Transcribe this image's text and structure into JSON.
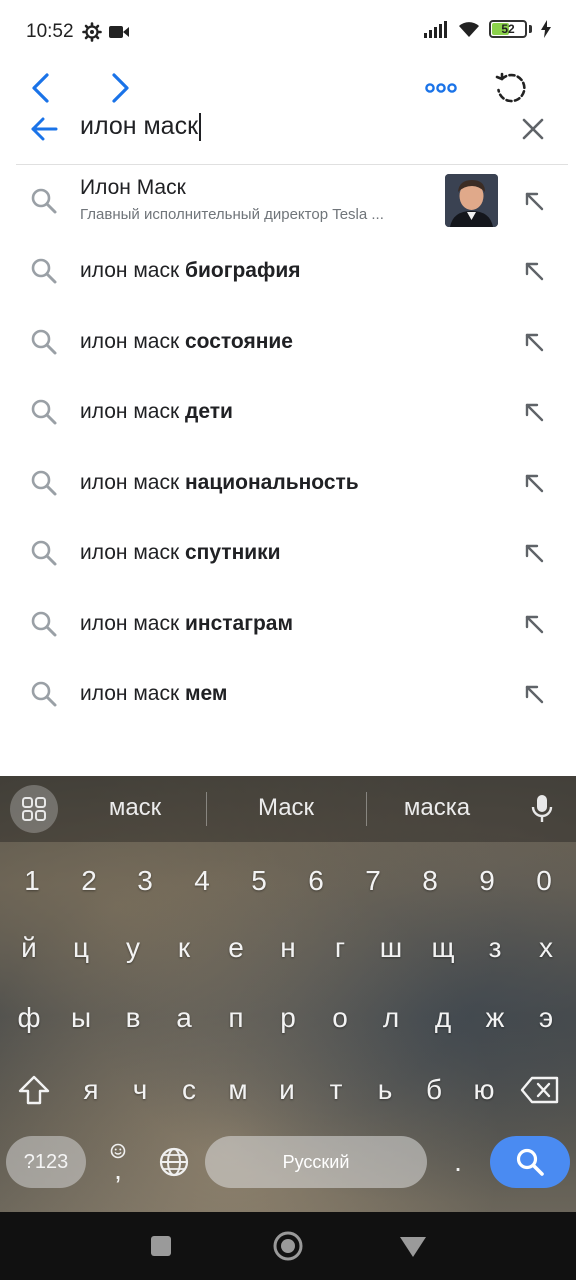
{
  "status": {
    "time": "10:52",
    "battery": "52",
    "battery_level": 0.52
  },
  "search": {
    "query": "илон маск"
  },
  "entity": {
    "title": "Илон Маск",
    "subtitle": "Главный исполнительный директор Tesla ..."
  },
  "suggestions": [
    {
      "prefix": "илон маск ",
      "bold": "биография"
    },
    {
      "prefix": "илон маск ",
      "bold": "состояние"
    },
    {
      "prefix": "илон маск ",
      "bold": "дети"
    },
    {
      "prefix": "илон маск ",
      "bold": "национальность"
    },
    {
      "prefix": "илон маск ",
      "bold": "спутники"
    },
    {
      "prefix": "илон маск ",
      "bold": "инстаграм"
    },
    {
      "prefix": "илон маск ",
      "bold": "мем"
    }
  ],
  "keyboard": {
    "word_suggestions": [
      "маск",
      "Маск",
      "маска"
    ],
    "numbers": [
      "1",
      "2",
      "3",
      "4",
      "5",
      "6",
      "7",
      "8",
      "9",
      "0"
    ],
    "row1": [
      "й",
      "ц",
      "у",
      "к",
      "е",
      "н",
      "г",
      "ш",
      "щ",
      "з",
      "х"
    ],
    "row2": [
      "ф",
      "ы",
      "в",
      "а",
      "п",
      "р",
      "о",
      "л",
      "д",
      "ж",
      "э"
    ],
    "row3": [
      "я",
      "ч",
      "с",
      "м",
      "и",
      "т",
      "ь",
      "б",
      "ю"
    ],
    "symbols_label": "?123",
    "comma": ",",
    "period": ".",
    "space_label": "Русский"
  },
  "colors": {
    "accent": "#1a73e8",
    "enter": "#4a8bf2"
  }
}
